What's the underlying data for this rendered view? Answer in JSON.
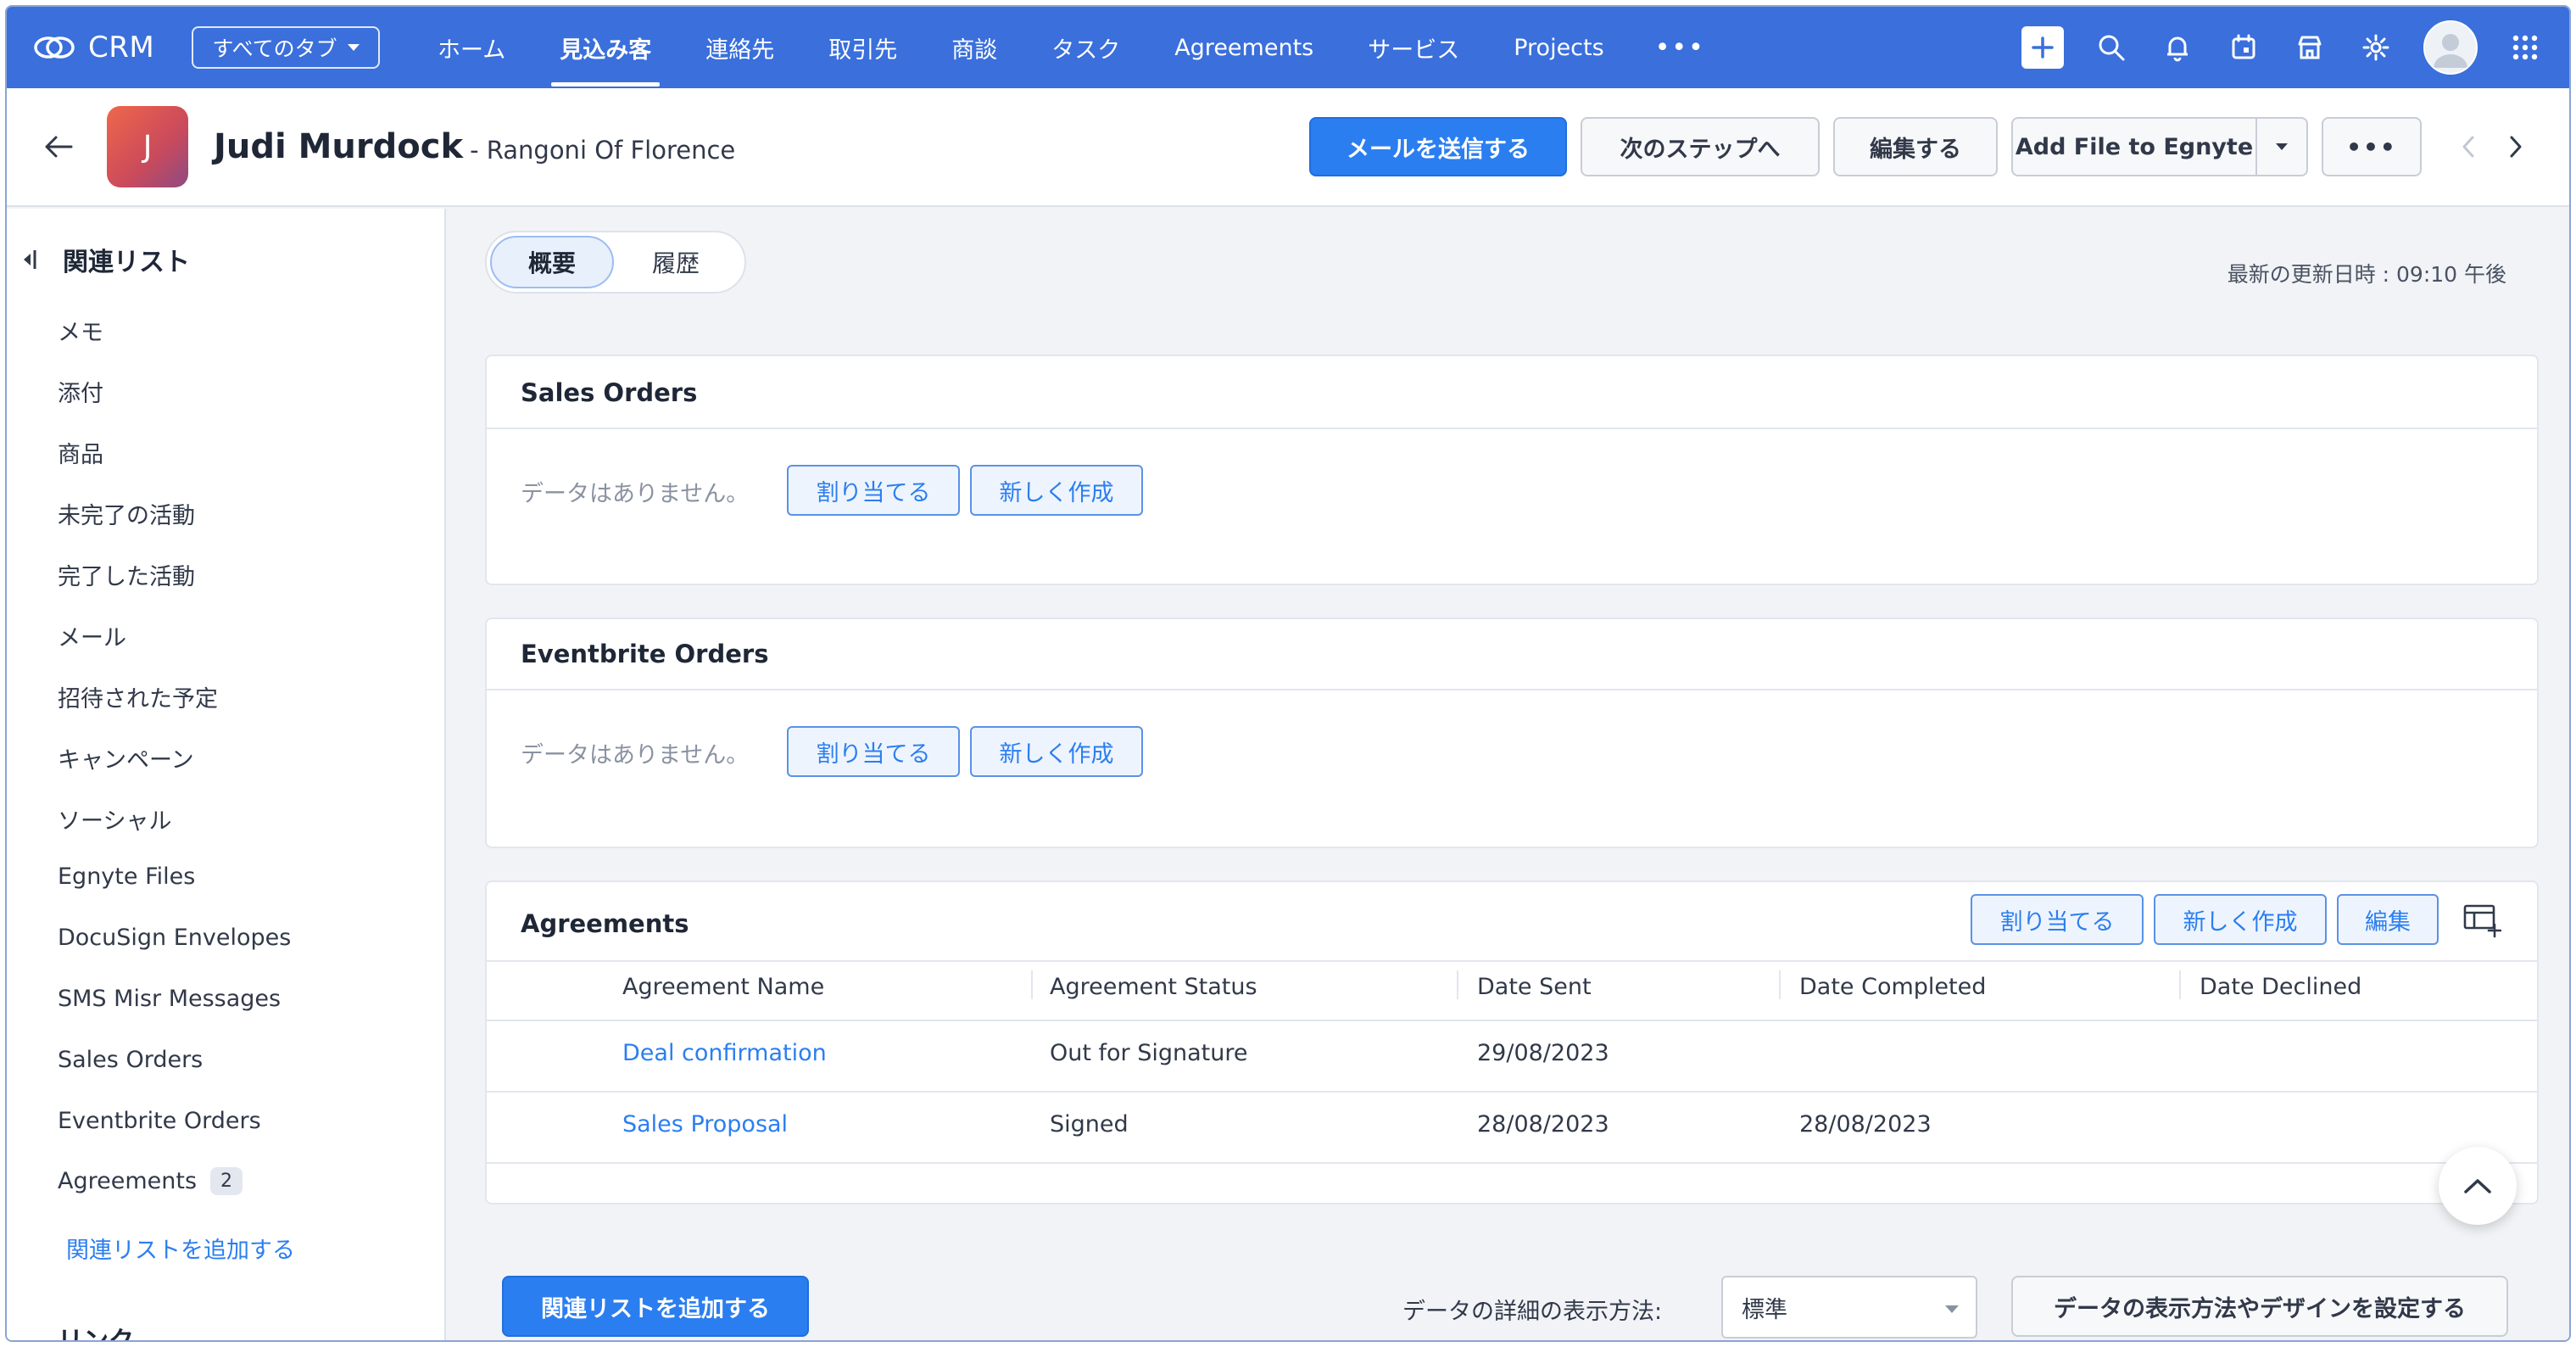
{
  "topnav": {
    "logo_text": "CRM",
    "all_tabs_label": "すべてのタブ",
    "items": [
      {
        "label": "ホーム",
        "active": false
      },
      {
        "label": "見込み客",
        "active": true
      },
      {
        "label": "連絡先",
        "active": false
      },
      {
        "label": "取引先",
        "active": false
      },
      {
        "label": "商談",
        "active": false
      },
      {
        "label": "タスク",
        "active": false
      },
      {
        "label": "Agreements",
        "active": false
      },
      {
        "label": "サービス",
        "active": false
      },
      {
        "label": "Projects",
        "active": false
      }
    ],
    "more_label": "•••"
  },
  "record": {
    "avatar_initial": "J",
    "name": "Judi Murdock",
    "company": "- Rangoni Of Florence",
    "send_mail_label": "メールを送信する",
    "next_step_label": "次のステップへ",
    "edit_label": "編集する",
    "egnyte_label": "Add File to Egnyte",
    "more_label": "•••"
  },
  "sidebar": {
    "heading": "関連リスト",
    "items": [
      {
        "label": "メモ"
      },
      {
        "label": "添付"
      },
      {
        "label": "商品"
      },
      {
        "label": "未完了の活動"
      },
      {
        "label": "完了した活動"
      },
      {
        "label": "メール"
      },
      {
        "label": "招待された予定"
      },
      {
        "label": "キャンペーン"
      },
      {
        "label": "ソーシャル"
      },
      {
        "label": "Egnyte Files"
      },
      {
        "label": "DocuSign Envelopes"
      },
      {
        "label": "SMS Misr Messages"
      },
      {
        "label": "Sales Orders"
      },
      {
        "label": "Eventbrite Orders"
      },
      {
        "label": "Agreements",
        "badge": "2"
      }
    ],
    "add_related_link": "関連リストを追加する",
    "links_heading": "リンク"
  },
  "main": {
    "tabs": [
      {
        "label": "概要",
        "active": true
      },
      {
        "label": "履歴",
        "active": false
      }
    ],
    "last_updated": "最新の更新日時 : 09:10 午後",
    "sales_orders": {
      "title": "Sales Orders",
      "no_data": "データはありません。",
      "assign_label": "割り当てる",
      "create_label": "新しく作成"
    },
    "eventbrite_orders": {
      "title": "Eventbrite Orders",
      "no_data": "データはありません。",
      "assign_label": "割り当てる",
      "create_label": "新しく作成"
    },
    "agreements": {
      "title": "Agreements",
      "assign_label": "割り当てる",
      "create_label": "新しく作成",
      "edit_label": "編集",
      "columns": [
        "Agreement Name",
        "Agreement Status",
        "Date Sent",
        "Date Completed",
        "Date Declined"
      ],
      "rows": [
        {
          "name": "Deal confirmation",
          "status": "Out for Signature",
          "sent": "29/08/2023",
          "completed": "",
          "declined": ""
        },
        {
          "name": "Sales Proposal",
          "status": "Signed",
          "sent": "28/08/2023",
          "completed": "28/08/2023",
          "declined": ""
        }
      ]
    },
    "bottom": {
      "add_related_button": "関連リストを追加する",
      "detail_view_label": "データの詳細の表示方法:",
      "detail_view_value": "標準",
      "design_button": "データの表示方法やデザインを設定する"
    }
  },
  "colors": {
    "nav_bg": "#3a6fdc",
    "primary": "#2b7ef0",
    "link": "#2b7ef0",
    "page_bg": "#f1f3f7"
  }
}
